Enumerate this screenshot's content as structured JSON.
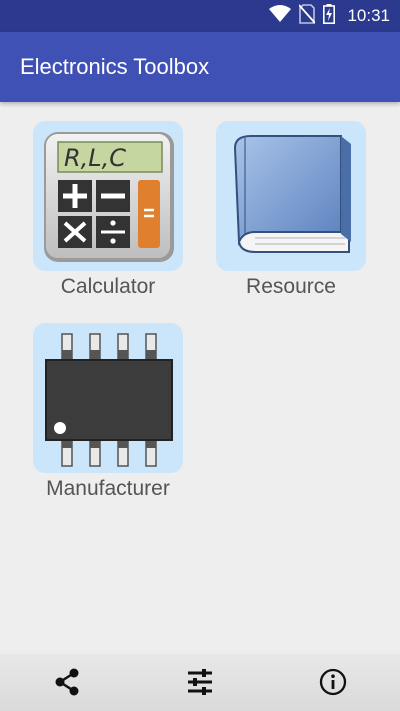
{
  "status_bar": {
    "time": "10:31",
    "icons": [
      "wifi-icon",
      "no-sim-icon",
      "battery-charging-icon"
    ]
  },
  "app_bar": {
    "title": "Electronics Toolbox"
  },
  "tiles": [
    {
      "label": "Calculator",
      "icon": "calculator-icon",
      "display_text": "R,L,C"
    },
    {
      "label": "Resource",
      "icon": "book-icon"
    },
    {
      "label": "Manufacturer",
      "icon": "ic-chip-icon"
    }
  ],
  "bottom_bar": {
    "buttons": [
      "share-icon",
      "settings-sliders-icon",
      "info-icon"
    ]
  },
  "colors": {
    "status_bar": "#2B3A8F",
    "app_bar": "#3F51B5",
    "tile_background": "#CBE6FA",
    "page_background": "#EEEEEE"
  }
}
